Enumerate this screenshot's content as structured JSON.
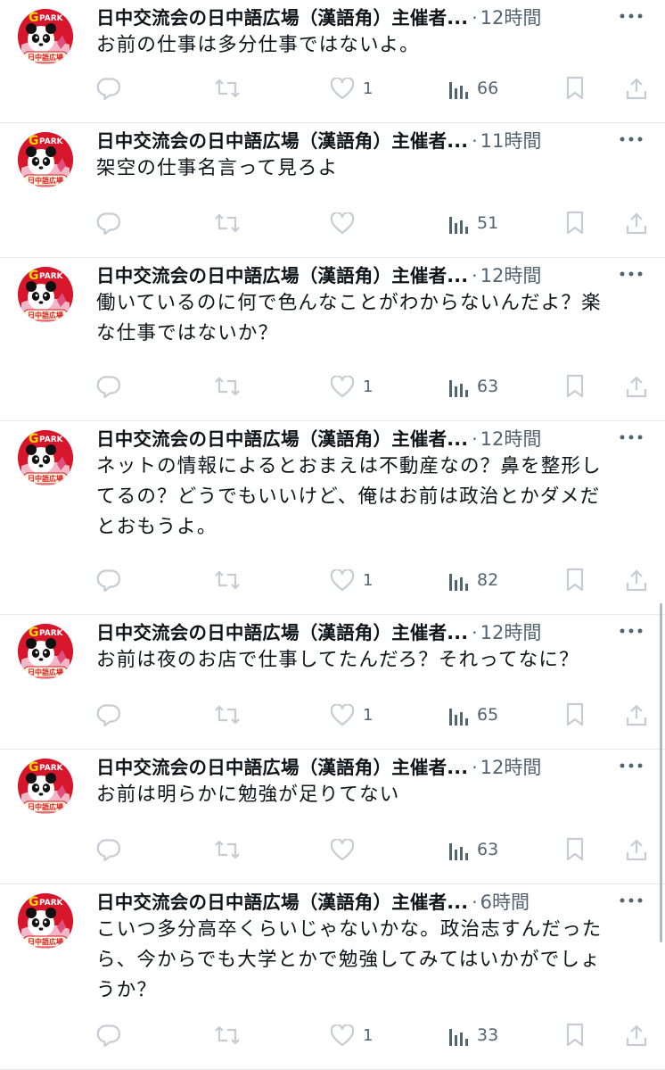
{
  "account": {
    "name": "日中交流会の日中語広場（漢語角）主催者...",
    "avatar_text_top": "PARK",
    "avatar_text_bottom": "日中語広場"
  },
  "tweets": [
    {
      "time": "12時間",
      "lines": [
        "お前の仕事は多分仕事ではないよ。"
      ],
      "likes": "1",
      "views": "66"
    },
    {
      "time": "11時間",
      "lines": [
        "架空の仕事名言って見ろよ"
      ],
      "likes": "",
      "views": "51"
    },
    {
      "time": "12時間",
      "lines": [
        "働いているのに何で色んなことがわからないんだよ？楽",
        "な仕事ではないか？"
      ],
      "likes": "1",
      "views": "63"
    },
    {
      "time": "12時間",
      "lines": [
        "ネットの情報によるとおまえは不動産なの？鼻を整形し",
        "てるの？どうでもいいけど、俺はお前は政治とかダメだ",
        "とおもうよ。"
      ],
      "likes": "1",
      "views": "82"
    },
    {
      "time": "12時間",
      "lines": [
        "お前は夜のお店で仕事してたんだろ？それってなに？"
      ],
      "likes": "1",
      "views": "65"
    },
    {
      "time": "12時間",
      "lines": [
        "お前は明らかに勉強が足りてない"
      ],
      "likes": "",
      "views": "63"
    },
    {
      "time": "6時間",
      "lines": [
        "こいつ多分高卒くらいじゃないかな。政治志すんだった",
        "ら、今からでも大学とかで勉強してみてはいかがでしょ",
        "うか？"
      ],
      "likes": "1",
      "views": "33"
    }
  ],
  "icons": {
    "reply": "reply-icon",
    "retweet": "retweet-icon",
    "like": "heart-icon",
    "views": "views-icon",
    "bookmark": "bookmark-icon",
    "share": "share-icon",
    "more": "more-icon"
  },
  "colors": {
    "text": "#0f1419",
    "muted": "#536471",
    "icon": "#c5ccd2",
    "divider": "#e6e9ec",
    "avatar_red": "#d7152b"
  }
}
